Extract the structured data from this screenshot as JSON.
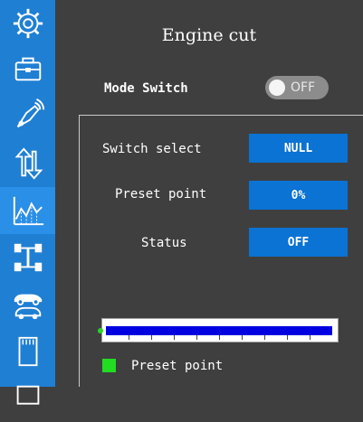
{
  "sidebar": {
    "items": [
      {
        "icon": "gear-icon"
      },
      {
        "icon": "toolbox-icon"
      },
      {
        "icon": "transmitter-icon"
      },
      {
        "icon": "up-down-arrows-icon"
      },
      {
        "icon": "curve-chart-icon",
        "active": true
      },
      {
        "icon": "chassis-icon"
      },
      {
        "icon": "car-swap-icon"
      },
      {
        "icon": "sd-card-icon"
      }
    ]
  },
  "header": {
    "title": "Engine cut"
  },
  "mode_switch": {
    "label": "Mode Switch",
    "value": "OFF"
  },
  "rows": [
    {
      "label": "Switch select",
      "value": "NULL"
    },
    {
      "label": "Preset point",
      "value": "0%"
    },
    {
      "label": "Status",
      "value": "OFF"
    }
  ],
  "bar": {
    "preset_fraction": 0.0
  },
  "legend": {
    "label": "Preset point",
    "color": "#22dc22"
  },
  "colors": {
    "accent": "#0a73d4",
    "sidebar": "#1f7fd3",
    "background": "#3f3f3f"
  }
}
